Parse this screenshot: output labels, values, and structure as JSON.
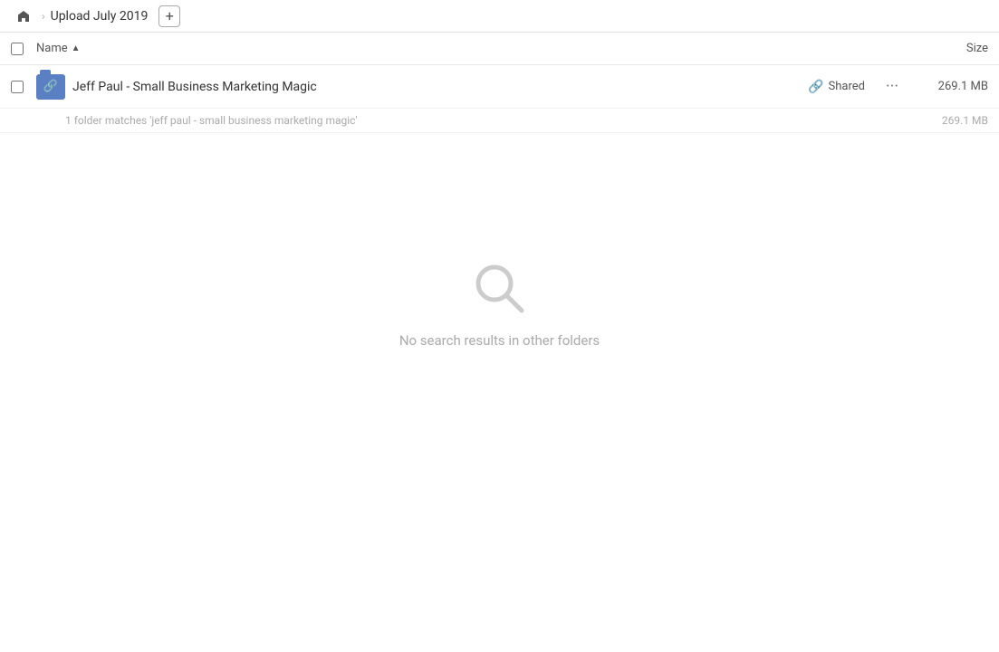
{
  "header": {
    "home_label": "Home",
    "breadcrumb_title": "Upload July 2019",
    "add_button_label": "+"
  },
  "columns": {
    "name_label": "Name",
    "sort_indicator": "▲",
    "size_label": "Size"
  },
  "folder_row": {
    "name": "Jeff Paul - Small Business Marketing Magic",
    "shared_label": "Shared",
    "more_label": "•••",
    "size": "269.1 MB"
  },
  "match_summary": {
    "text": "1 folder matches 'jeff paul - small business marketing magic'",
    "size": "269.1 MB"
  },
  "empty_state": {
    "label": "No search results in other folders"
  }
}
